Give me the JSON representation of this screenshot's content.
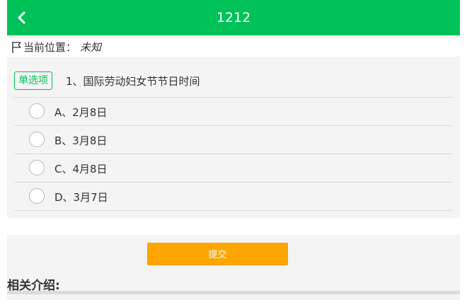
{
  "header": {
    "title": "1212",
    "back_icon": "chevron-left-icon",
    "color": "#00c258"
  },
  "location": {
    "icon": "flag-icon",
    "label": "当前位置：",
    "value": "未知"
  },
  "question": {
    "type_badge": "单选项",
    "text": "1、国际劳动妇女节节日时间",
    "options": [
      {
        "label": "A、2月8日"
      },
      {
        "label": "B、3月8日"
      },
      {
        "label": "C、4月8日"
      },
      {
        "label": "D、3月7日"
      }
    ]
  },
  "submit": {
    "label": "提交",
    "color": "#ffa500"
  },
  "related": {
    "heading": "相关介绍:"
  }
}
